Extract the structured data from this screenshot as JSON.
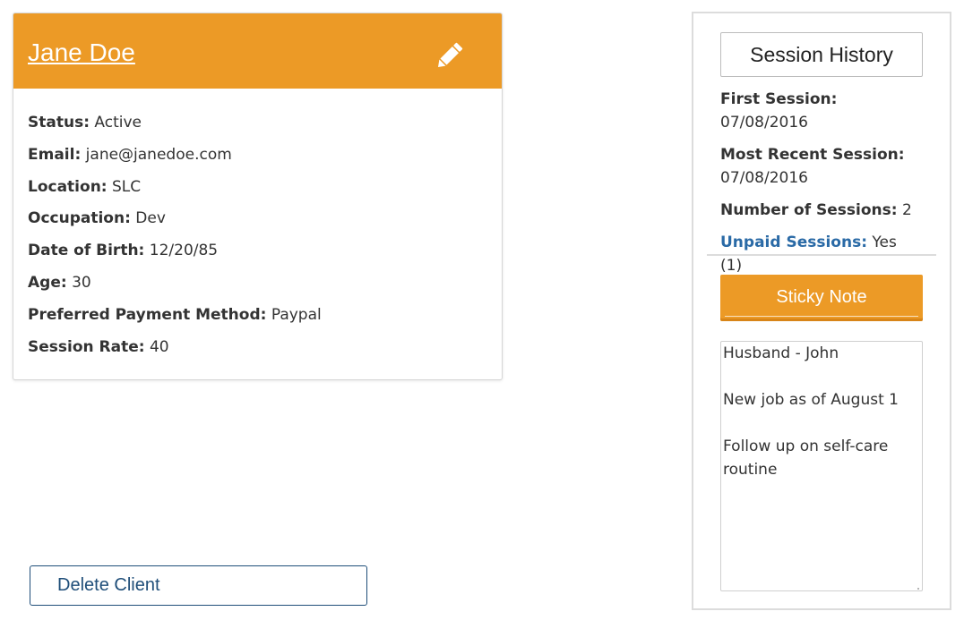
{
  "client": {
    "name": "Jane Doe",
    "fields": [
      {
        "label": "Status:",
        "value": "Active"
      },
      {
        "label": "Email:",
        "value": "jane@janedoe.com"
      },
      {
        "label": "Location:",
        "value": "SLC"
      },
      {
        "label": "Occupation:",
        "value": "Dev"
      },
      {
        "label": "Date of Birth:",
        "value": "12/20/85"
      },
      {
        "label": "Age:",
        "value": "30"
      },
      {
        "label": "Preferred Payment Method:",
        "value": "Paypal"
      },
      {
        "label": "Session Rate:",
        "value": "40"
      }
    ],
    "edit_icon": "pencil-icon"
  },
  "actions": {
    "delete_label": "Delete Client"
  },
  "side_panel": {
    "session_history_label": "Session History",
    "first_session_label": "First Session:",
    "first_session_value": "07/08/2016",
    "recent_session_label": "Most Recent Session:",
    "recent_session_value": "07/08/2016",
    "num_sessions_label": "Number of Sessions:",
    "num_sessions_value": "2",
    "unpaid_label": "Unpaid Sessions:",
    "unpaid_value": "Yes (1)",
    "sticky_note_label": "Sticky Note",
    "note_lines": [
      "Husband - John",
      "",
      "New job as of August 1",
      "",
      "Follow up on self-care",
      "routine"
    ]
  },
  "colors": {
    "accent": "#ec9a26",
    "link": "#2a6aa6",
    "delete_border": "#1f4e79"
  }
}
